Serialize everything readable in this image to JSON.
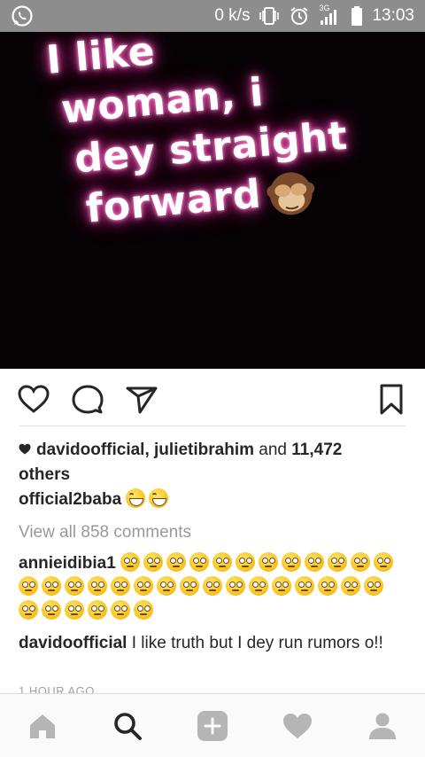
{
  "status_bar": {
    "speed": "0 k/s",
    "network": "3G",
    "time": "13:03"
  },
  "post": {
    "image_text": {
      "line1": "I like",
      "line2": "woman, i",
      "line3": "dey straight",
      "line4": "forward"
    },
    "likes": {
      "user1": "davidoofficial",
      "separator": ",",
      "user2": "julietibrahim",
      "and_text": "and",
      "count": "11,472",
      "others_text": "others"
    },
    "caption": {
      "user": "official2baba"
    },
    "view_all_comments": "View all 858 comments",
    "comments": [
      {
        "user": "annieidibia1",
        "text": ""
      },
      {
        "user": "davidoofficial",
        "text": "I like truth but I dey run rumors o!!"
      }
    ],
    "timestamp": "1 HOUR AGO"
  },
  "icons": {
    "status": [
      "whatsapp-icon",
      "vibrate-icon",
      "alarm-icon",
      "signal-icon",
      "battery-icon"
    ],
    "actions": [
      "like-heart-icon",
      "comment-bubble-icon",
      "share-direct-icon",
      "save-bookmark-icon"
    ],
    "nav": [
      "home-icon",
      "search-icon",
      "add-post-icon",
      "activity-heart-icon",
      "profile-icon"
    ]
  },
  "colors": {
    "status_bar": "#8d8d8d",
    "image_background": "#070305",
    "glow": "#e04aa8",
    "text": "#262626",
    "muted": "#999999",
    "emoji": "#f9c623"
  }
}
